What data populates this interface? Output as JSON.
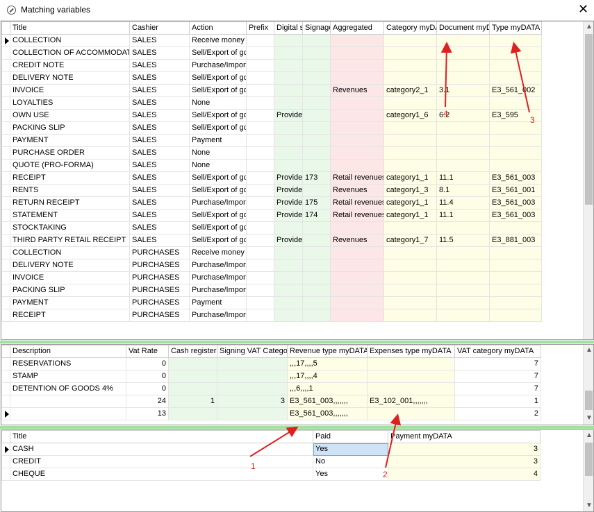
{
  "window": {
    "title": "Matching variables",
    "close": "✕"
  },
  "colors": {
    "green": "#eaf8ea",
    "pink": "#fde6e6",
    "yellow": "#fefee6",
    "annotation": "#e01f1f",
    "splitter": "#9ee29e"
  },
  "grid1": {
    "headers": [
      "Title",
      "Cashier",
      "Action",
      "Prefix",
      "Digital s",
      "Signage",
      "Aggregated",
      "Category myDA",
      "Document myD",
      "Type myDATA"
    ],
    "rows": [
      [
        "COLLECTION",
        "SALES",
        "Receive money",
        "",
        "",
        "",
        "",
        "",
        "",
        ""
      ],
      [
        "COLLECTION OF ACCOMMODATIO",
        "SALES",
        "Sell/Export of gc",
        "",
        "",
        "",
        "",
        "",
        "",
        ""
      ],
      [
        "CREDIT NOTE",
        "SALES",
        "Purchase/Import",
        "",
        "",
        "",
        "",
        "",
        "",
        ""
      ],
      [
        "DELIVERY NOTE",
        "SALES",
        "Sell/Export of gc",
        "",
        "",
        "",
        "",
        "",
        "",
        ""
      ],
      [
        "INVOICE",
        "SALES",
        "Sell/Export of gc",
        "",
        "",
        "",
        "Revenues",
        "category2_1",
        "3.1",
        "E3_561_002"
      ],
      [
        "LOYALTIES",
        "SALES",
        "None",
        "",
        "",
        "",
        "",
        "",
        "",
        ""
      ],
      [
        "OWN USE",
        "SALES",
        "Sell/Export of gc",
        "",
        "Provide",
        "",
        "",
        "category1_6",
        "6.2",
        "E3_595"
      ],
      [
        "PACKING SLIP",
        "SALES",
        "Sell/Export of gc",
        "",
        "",
        "",
        "",
        "",
        "",
        ""
      ],
      [
        "PAYMENT",
        "SALES",
        "Payment",
        "",
        "",
        "",
        "",
        "",
        "",
        ""
      ],
      [
        "PURCHASE ORDER",
        "SALES",
        "None",
        "",
        "",
        "",
        "",
        "",
        "",
        ""
      ],
      [
        "QUOTE (PRO-FORMA)",
        "SALES",
        "None",
        "",
        "",
        "",
        "",
        "",
        "",
        ""
      ],
      [
        "RECEIPT",
        "SALES",
        "Sell/Export of gc",
        "",
        "Provide",
        "173",
        "Retail revenues",
        "category1_1",
        "11.1",
        "E3_561_003"
      ],
      [
        "RENTS",
        "SALES",
        "Sell/Export of gc",
        "",
        "Provide",
        "",
        "Revenues",
        "category1_3",
        "8.1",
        "E3_561_001"
      ],
      [
        "RETURN RECEIPT",
        "SALES",
        "Purchase/Import",
        "",
        "Provide",
        "175",
        "Retail revenues",
        "category1_1",
        "11.4",
        "E3_561_003"
      ],
      [
        "STATEMENT",
        "SALES",
        "Sell/Export of gc",
        "",
        "Provide",
        "174",
        "Retail revenues",
        "category1_1",
        "11.1",
        "E3_561_003"
      ],
      [
        "STOCKTAKING",
        "SALES",
        "Sell/Export of gc",
        "",
        "",
        "",
        "",
        "",
        "",
        ""
      ],
      [
        "THIRD PARTY RETAIL RECEIPT",
        "SALES",
        "Sell/Export of gc",
        "",
        "Provide",
        "",
        "Revenues",
        "category1_7",
        "11.5",
        "E3_881_003"
      ],
      [
        "COLLECTION",
        "PURCHASES",
        "Receive money",
        "",
        "",
        "",
        "",
        "",
        "",
        ""
      ],
      [
        "DELIVERY NOTE",
        "PURCHASES",
        "Purchase/Import",
        "",
        "",
        "",
        "",
        "",
        "",
        ""
      ],
      [
        "INVOICE",
        "PURCHASES",
        "Purchase/Import",
        "",
        "",
        "",
        "",
        "",
        "",
        ""
      ],
      [
        "PACKING SLIP",
        "PURCHASES",
        "Purchase/Import",
        "",
        "",
        "",
        "",
        "",
        "",
        ""
      ],
      [
        "PAYMENT",
        "PURCHASES",
        "Payment",
        "",
        "",
        "",
        "",
        "",
        "",
        ""
      ],
      [
        "RECEIPT",
        "PURCHASES",
        "Purchase/Import",
        "",
        "",
        "",
        "",
        "",
        "",
        ""
      ]
    ]
  },
  "grid2": {
    "headers": [
      "Description",
      "Vat Rate",
      "Cash register",
      "Signing VAT Catego",
      "Revenue type myDATA",
      "Expenses type myDATA",
      "VAT category myDATA"
    ],
    "rows": [
      [
        "RESERVATIONS",
        "0",
        "",
        "",
        ",,,17,,,,5",
        "",
        "7"
      ],
      [
        "STAMP",
        "0",
        "",
        "",
        ",,,17,,,,4",
        "",
        "7"
      ],
      [
        "DETENTION OF GOODS 4%",
        "0",
        "",
        "",
        ",,,6,,,,1",
        "",
        "7"
      ],
      [
        "",
        "24",
        "1",
        "3",
        "E3_561_003,,,,,,,",
        "E3_102_001,,,,,,,",
        "1"
      ],
      [
        "",
        "13",
        "",
        "",
        "E3_561_003,,,,,,,",
        "",
        "2"
      ]
    ]
  },
  "grid3": {
    "headers": [
      "Title",
      "Paid",
      "Payment myDATA"
    ],
    "rows": [
      [
        "CASH",
        "Yes",
        "3"
      ],
      [
        "CREDIT",
        "No",
        "3"
      ],
      [
        "CHEQUE",
        "Yes",
        "4"
      ]
    ]
  },
  "annotations": [
    "1",
    "2",
    "3",
    "4"
  ]
}
